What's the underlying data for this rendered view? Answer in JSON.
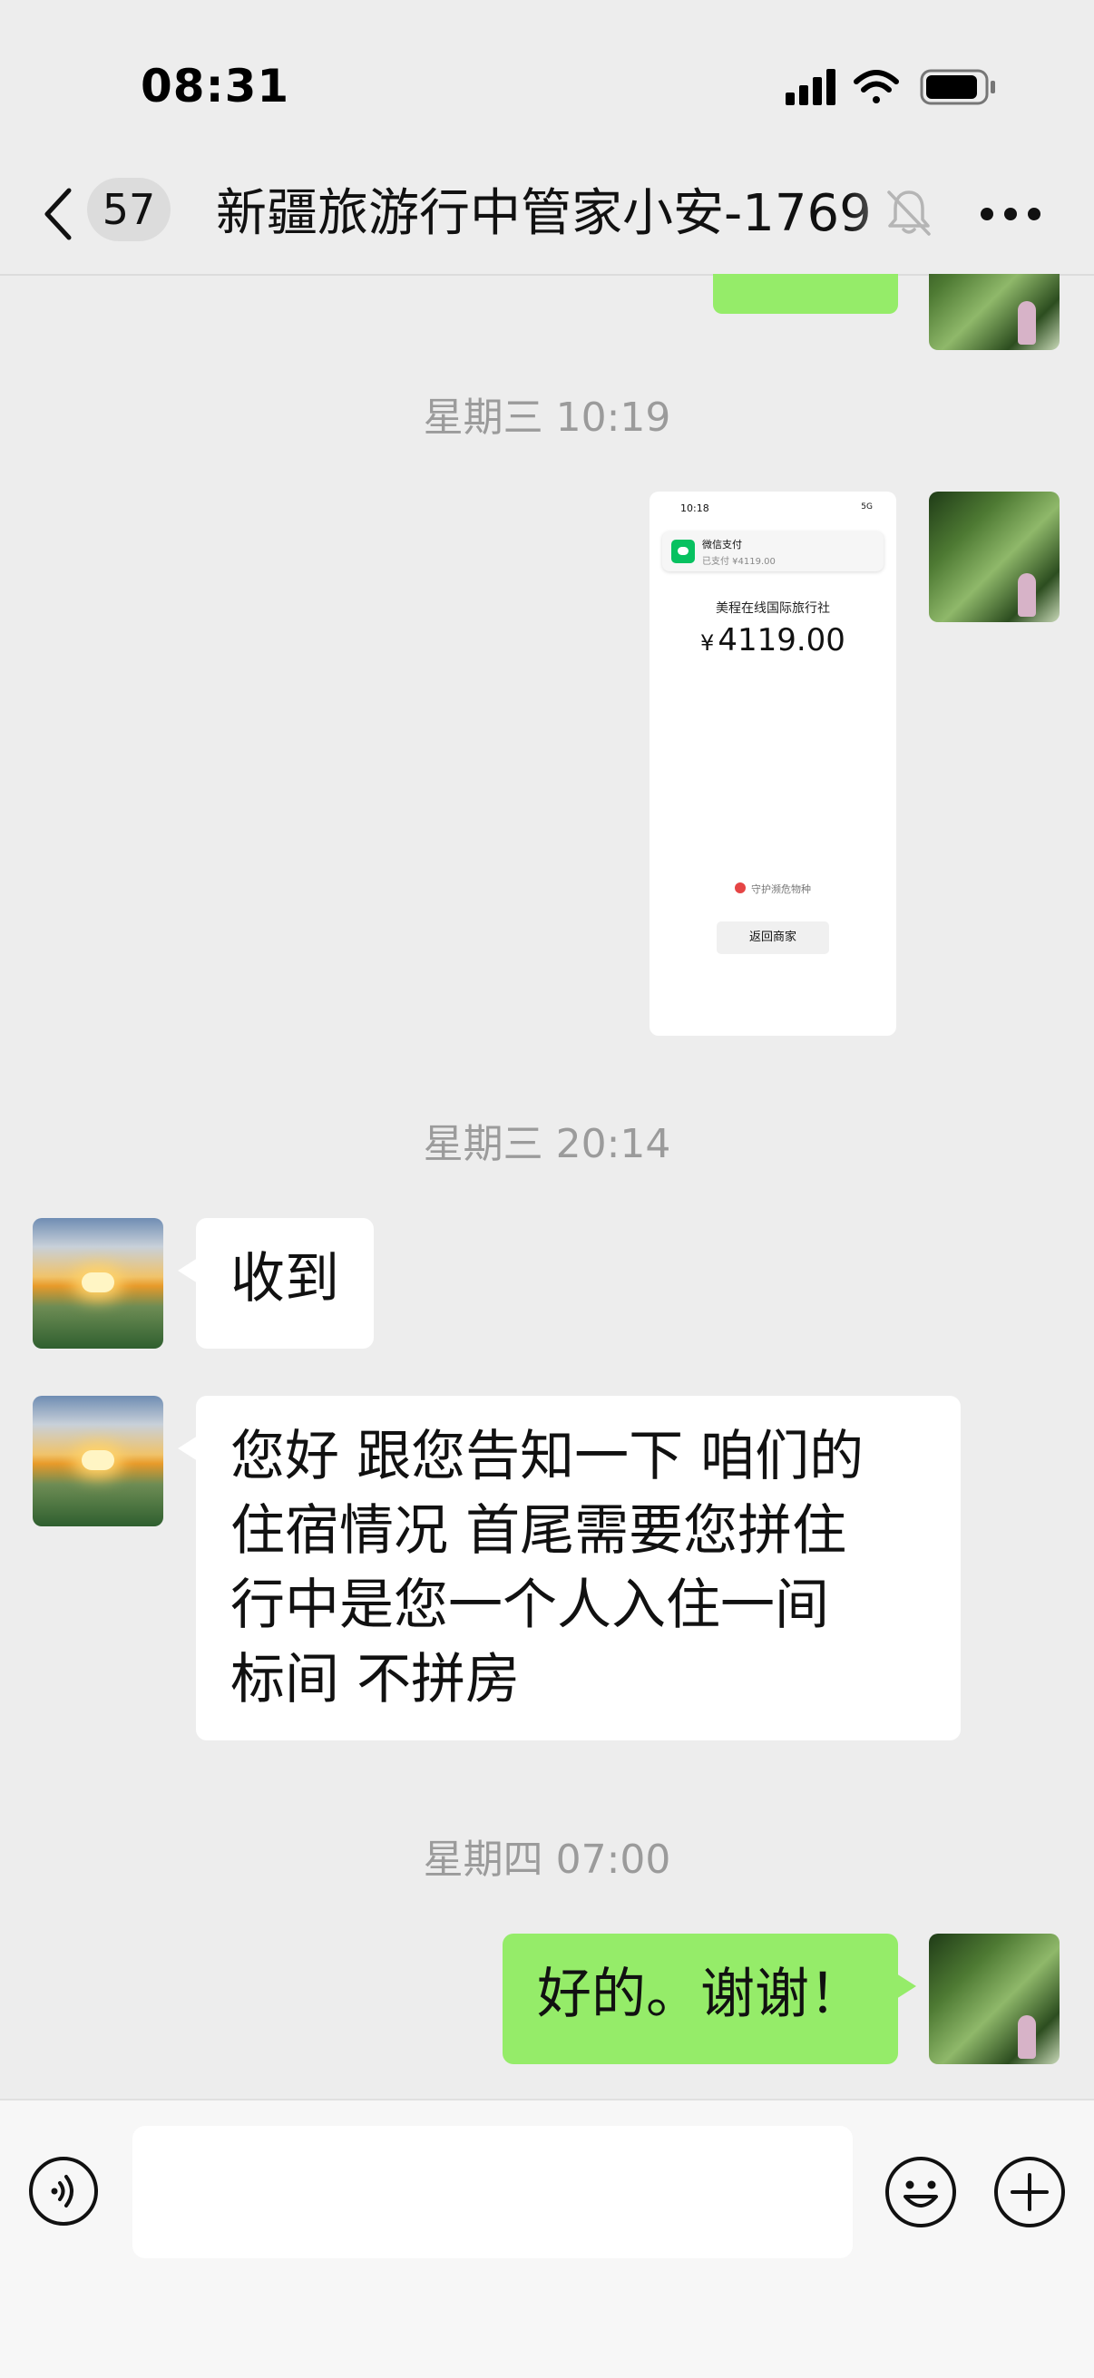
{
  "status_bar": {
    "time": "08:31",
    "icons": [
      "signal-bars-icon",
      "wifi-icon",
      "battery-icon"
    ]
  },
  "nav": {
    "unread_count": "57",
    "title": "新疆旅游行中管家小安-1769",
    "icons": [
      "back-chevron-icon",
      "mute-bell-icon",
      "more-dots-icon"
    ]
  },
  "messages": [
    {
      "type": "image",
      "from": "self",
      "description_text": {
        "time": "10:18",
        "system": "5G",
        "toast_title": "微信支付",
        "toast_sub": "已支付 ¥4119.00",
        "merchant": "美程在线国际旅行社",
        "currency": "¥",
        "amount": "4119.00",
        "protect": "守护濒危物种",
        "return_button": "返回商家"
      }
    }
  ],
  "timestamps": [
    "星期三 10:19",
    "星期三 20:14",
    "星期四 07:00"
  ],
  "chat": {
    "msg_received_1": "收到",
    "msg_received_2": "您好  跟您告知一下 咱们的住宿情况 首尾需要您拼住行中是您一个人入住一间标间  不拼房",
    "msg_received_2_lines": [
      "您好  跟您告知一下 咱们的",
      "住宿情况 首尾需要您拼住",
      "行中是您一个人入住一间",
      "标间  不拼房"
    ],
    "msg_sent_1": "好的。谢谢！"
  },
  "input_bar": {
    "placeholder": "",
    "icons": [
      "voice-icon",
      "emoji-icon",
      "plus-icon"
    ]
  },
  "colors": {
    "background": "#ededed",
    "sent_bubble": "#95ec69",
    "received_bubble": "#ffffff",
    "timestamp_text": "#9b9b9b",
    "wechat_pay_green": "#07c160"
  }
}
